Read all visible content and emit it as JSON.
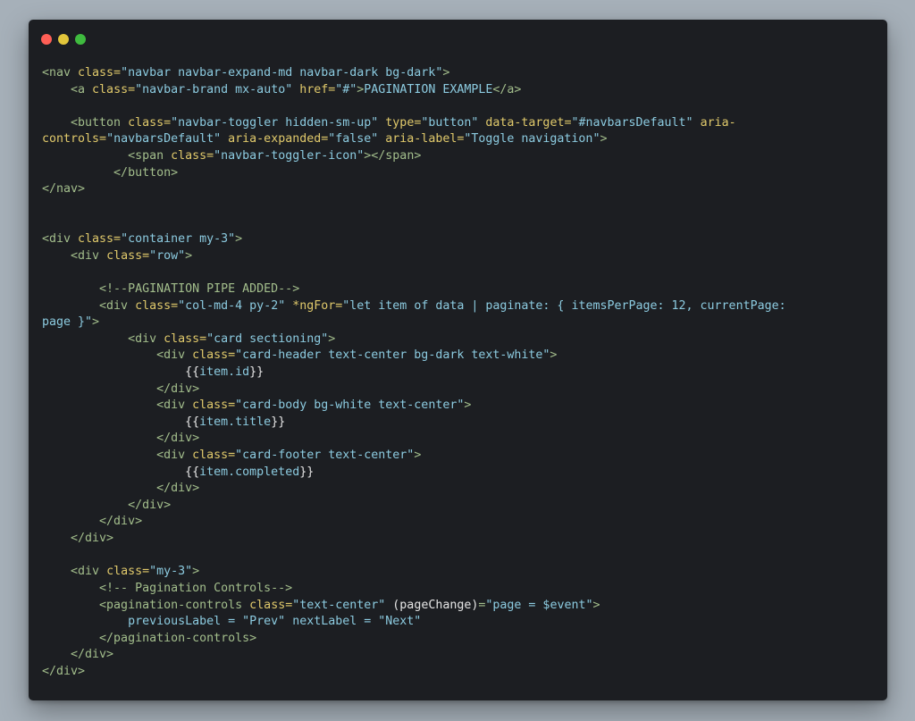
{
  "window": {
    "buttons": [
      {
        "name": "close",
        "color": "#ff5f56"
      },
      {
        "name": "minimize",
        "color": "#e2c63b"
      },
      {
        "name": "maximize",
        "color": "#3fbb3f"
      }
    ]
  },
  "colors": {
    "tag": "#a3be8c",
    "attribute": "#e0c96b",
    "string": "#8ccbe0",
    "text": "#8ccbe0",
    "punctuation": "#e6e6e6",
    "background": "#1c1e22",
    "page_background": "#a6b0b9"
  },
  "code_lines": [
    [
      {
        "t": "tag",
        "v": "<nav "
      },
      {
        "t": "attr",
        "v": "class="
      },
      {
        "t": "str",
        "v": "\"navbar navbar-expand-md navbar-dark bg-dark\""
      },
      {
        "t": "tag",
        "v": ">"
      }
    ],
    [
      {
        "t": "tag",
        "v": "    <a "
      },
      {
        "t": "attr",
        "v": "class="
      },
      {
        "t": "str",
        "v": "\"navbar-brand mx-auto\" "
      },
      {
        "t": "attr",
        "v": "href="
      },
      {
        "t": "str",
        "v": "\"#\""
      },
      {
        "t": "tag",
        "v": ">"
      },
      {
        "t": "txt",
        "v": "PAGINATION EXAMPLE"
      },
      {
        "t": "tag",
        "v": "</a>"
      }
    ],
    [],
    [
      {
        "t": "tag",
        "v": "    <button "
      },
      {
        "t": "attr",
        "v": "class="
      },
      {
        "t": "str",
        "v": "\"navbar-toggler hidden-sm-up\" "
      },
      {
        "t": "attr",
        "v": "type="
      },
      {
        "t": "str",
        "v": "\"button\" "
      },
      {
        "t": "attr",
        "v": "data-target="
      },
      {
        "t": "str",
        "v": "\"#navbarsDefault\" "
      },
      {
        "t": "attr",
        "v": "aria-"
      }
    ],
    [
      {
        "t": "attr",
        "v": "controls="
      },
      {
        "t": "str",
        "v": "\"navbarsDefault\" "
      },
      {
        "t": "attr",
        "v": "aria-expanded="
      },
      {
        "t": "str",
        "v": "\"false\" "
      },
      {
        "t": "attr",
        "v": "aria-label="
      },
      {
        "t": "str",
        "v": "\"Toggle navigation\""
      },
      {
        "t": "tag",
        "v": ">"
      }
    ],
    [
      {
        "t": "tag",
        "v": "            <span "
      },
      {
        "t": "attr",
        "v": "class="
      },
      {
        "t": "str",
        "v": "\"navbar-toggler-icon\""
      },
      {
        "t": "tag",
        "v": "></span>"
      }
    ],
    [
      {
        "t": "tag",
        "v": "          </button>"
      }
    ],
    [
      {
        "t": "tag",
        "v": "</nav>"
      }
    ],
    [],
    [],
    [
      {
        "t": "tag",
        "v": "<div "
      },
      {
        "t": "attr",
        "v": "class="
      },
      {
        "t": "str",
        "v": "\"container my-3\""
      },
      {
        "t": "tag",
        "v": ">"
      }
    ],
    [
      {
        "t": "tag",
        "v": "    <div "
      },
      {
        "t": "attr",
        "v": "class="
      },
      {
        "t": "str",
        "v": "\"row\""
      },
      {
        "t": "tag",
        "v": ">"
      }
    ],
    [],
    [
      {
        "t": "cm",
        "v": "        <!--PAGINATION PIPE ADDED-->"
      }
    ],
    [
      {
        "t": "tag",
        "v": "        <div "
      },
      {
        "t": "attr",
        "v": "class="
      },
      {
        "t": "str",
        "v": "\"col-md-4 py-2\" "
      },
      {
        "t": "attr",
        "v": "*ngFor="
      },
      {
        "t": "str",
        "v": "\"let item of data | paginate: { itemsPerPage: 12, currentPage:"
      }
    ],
    [
      {
        "t": "str",
        "v": "page }\""
      },
      {
        "t": "tag",
        "v": ">"
      }
    ],
    [
      {
        "t": "tag",
        "v": "            <div "
      },
      {
        "t": "attr",
        "v": "class="
      },
      {
        "t": "str",
        "v": "\"card sectioning\""
      },
      {
        "t": "tag",
        "v": ">"
      }
    ],
    [
      {
        "t": "tag",
        "v": "                <div "
      },
      {
        "t": "attr",
        "v": "class="
      },
      {
        "t": "str",
        "v": "\"card-header text-center bg-dark text-white\""
      },
      {
        "t": "tag",
        "v": ">"
      }
    ],
    [
      {
        "t": "pun",
        "v": "                    {{"
      },
      {
        "t": "txt",
        "v": "item.id"
      },
      {
        "t": "pun",
        "v": "}}"
      }
    ],
    [
      {
        "t": "tag",
        "v": "                </div>"
      }
    ],
    [
      {
        "t": "tag",
        "v": "                <div "
      },
      {
        "t": "attr",
        "v": "class="
      },
      {
        "t": "str",
        "v": "\"card-body bg-white text-center\""
      },
      {
        "t": "tag",
        "v": ">"
      }
    ],
    [
      {
        "t": "pun",
        "v": "                    {{"
      },
      {
        "t": "txt",
        "v": "item.title"
      },
      {
        "t": "pun",
        "v": "}}"
      }
    ],
    [
      {
        "t": "tag",
        "v": "                </div>"
      }
    ],
    [
      {
        "t": "tag",
        "v": "                <div "
      },
      {
        "t": "attr",
        "v": "class="
      },
      {
        "t": "str",
        "v": "\"card-footer text-center\""
      },
      {
        "t": "tag",
        "v": ">"
      }
    ],
    [
      {
        "t": "pun",
        "v": "                    {{"
      },
      {
        "t": "txt",
        "v": "item.completed"
      },
      {
        "t": "pun",
        "v": "}}"
      }
    ],
    [
      {
        "t": "tag",
        "v": "                </div>"
      }
    ],
    [
      {
        "t": "tag",
        "v": "            </div>"
      }
    ],
    [
      {
        "t": "tag",
        "v": "        </div>"
      }
    ],
    [
      {
        "t": "tag",
        "v": "    </div>"
      }
    ],
    [],
    [
      {
        "t": "tag",
        "v": "    <div "
      },
      {
        "t": "attr",
        "v": "class="
      },
      {
        "t": "str",
        "v": "\"my-3\""
      },
      {
        "t": "tag",
        "v": ">"
      }
    ],
    [
      {
        "t": "cm",
        "v": "        <!-- Pagination Controls-->"
      }
    ],
    [
      {
        "t": "tag",
        "v": "        <pagination-controls "
      },
      {
        "t": "attr",
        "v": "class="
      },
      {
        "t": "str",
        "v": "\"text-center\" "
      },
      {
        "t": "pun",
        "v": "(pageChange)"
      },
      {
        "t": "tag",
        "v": "="
      },
      {
        "t": "str",
        "v": "\"page = $event\""
      },
      {
        "t": "tag",
        "v": ">"
      }
    ],
    [
      {
        "t": "txt",
        "v": "            previousLabel = \"Prev\" nextLabel = \"Next\""
      }
    ],
    [
      {
        "t": "tag",
        "v": "        </pagination-controls>"
      }
    ],
    [
      {
        "t": "tag",
        "v": "    </div>"
      }
    ],
    [
      {
        "t": "tag",
        "v": "</div>"
      }
    ]
  ]
}
